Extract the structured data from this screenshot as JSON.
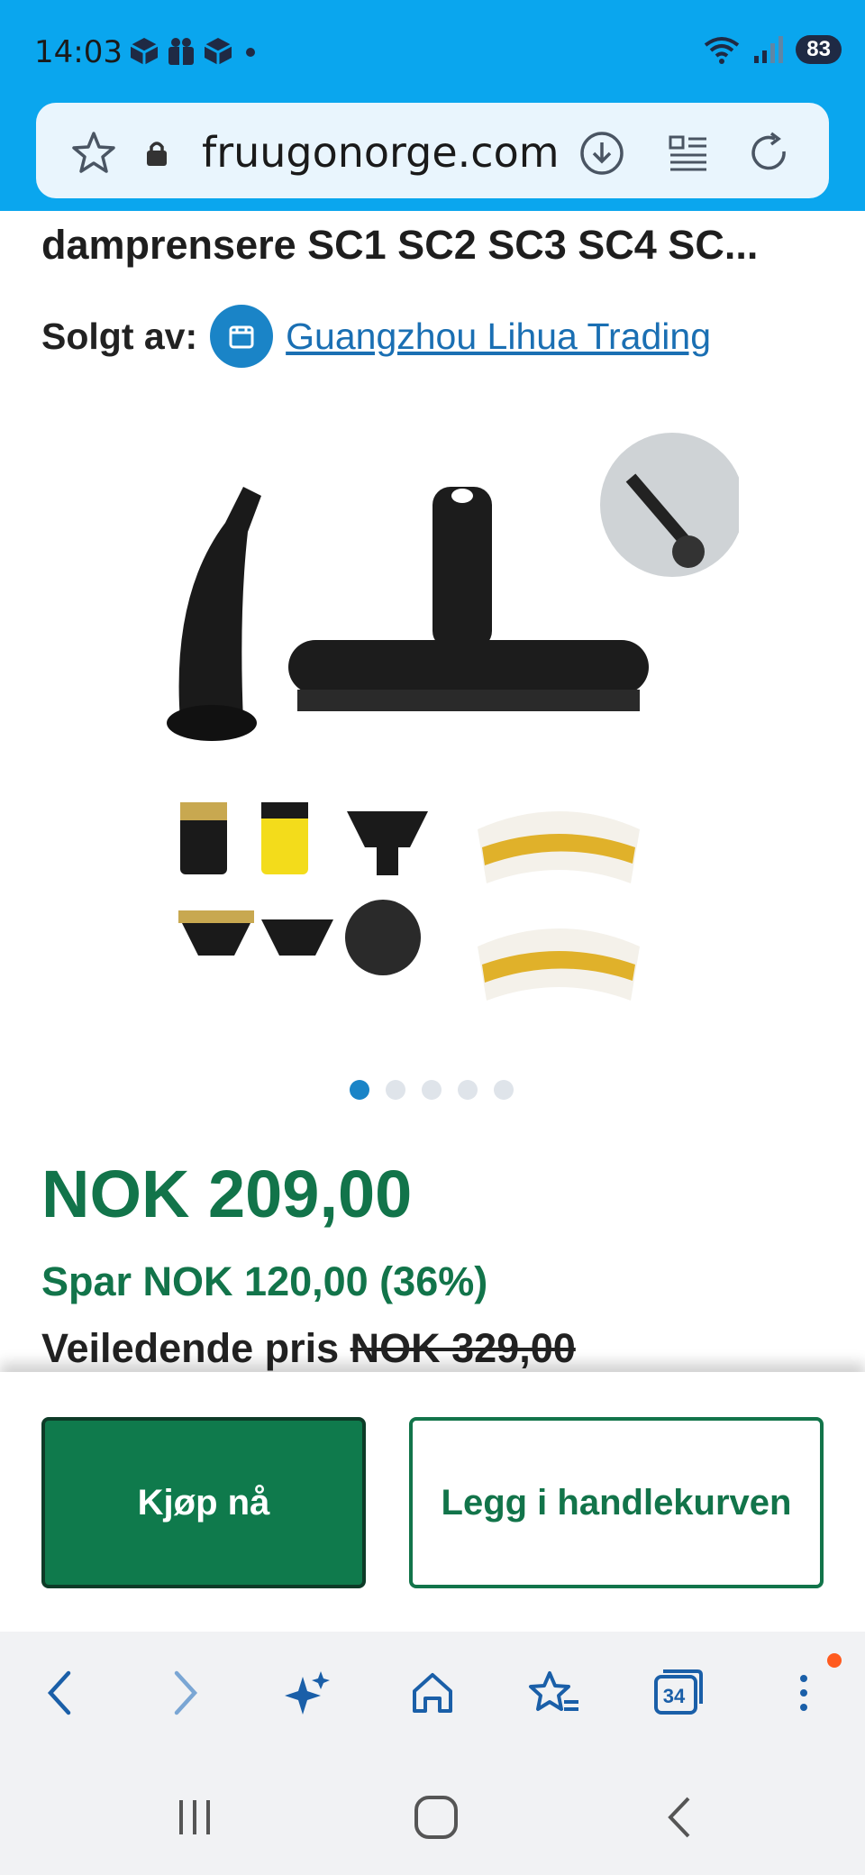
{
  "status": {
    "time": "14:03",
    "battery": "83"
  },
  "browser": {
    "url": "fruugonorge.com",
    "tab_count": "34"
  },
  "product": {
    "title": "damprensere SC1 SC2 SC3 SC4 SC...",
    "seller_label": "Solgt av:",
    "seller_name": "Guangzhou Lihua Trading",
    "image_count": 5,
    "active_image": 1,
    "price": "NOK 209,00",
    "savings": "Spar NOK 120,00 (36%)",
    "rrp_label": "Veiledende pris",
    "rrp_value": "NOK 329,00"
  },
  "actions": {
    "buy_now": "Kjøp nå",
    "add_to_cart": "Legg i handlekurven"
  },
  "colors": {
    "status_bar": "#0aa6ee",
    "price_green": "#12744a",
    "buy_button": "#0f7a4c",
    "link_blue": "#1a6fb3"
  },
  "icons": {
    "toolbar": [
      "back-icon",
      "forward-icon",
      "sparkle-icon",
      "home-icon",
      "bookmarks-icon",
      "tabs-icon",
      "more-icon"
    ],
    "urlbar": [
      "star-icon",
      "lock-icon",
      "download-icon",
      "reader-icon",
      "reload-icon"
    ],
    "navbar": [
      "recents-icon",
      "home-nav-icon",
      "back-nav-icon"
    ]
  }
}
